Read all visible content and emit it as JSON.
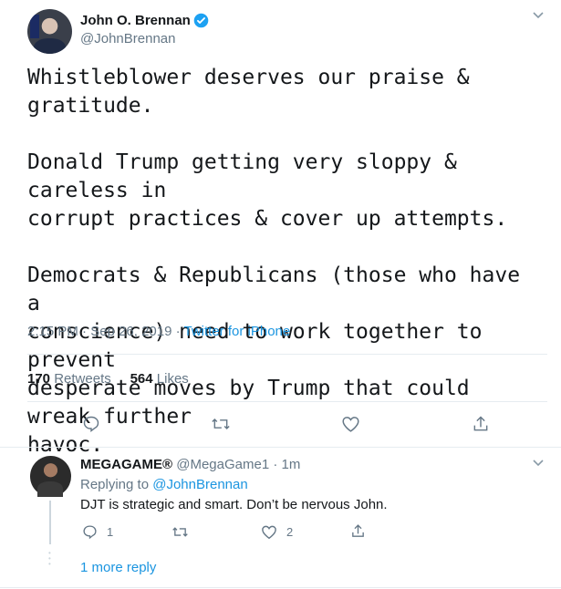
{
  "tweet": {
    "author_name": "John O. Brennan",
    "author_handle": "@JohnBrennan",
    "text": "Whistleblower deserves our praise & gratitude.\n\nDonald Trump getting very sloppy & careless in\ncorrupt practices & cover up attempts.\n\nDemocrats & Republicans (those who have a\nconscience) need to work together to prevent\ndesperate moves by Trump that could wreak further\nhavoc.",
    "timestamp": "2:15 PM · Sep 26, 2019 · ",
    "source": "Twitter for iPhone",
    "retweets_count": "170",
    "retweets_label": "Retweets",
    "likes_count": "564",
    "likes_label": "Likes"
  },
  "reply": {
    "author_name": "MEGAGAME®",
    "author_handle": "@MegaGame1 · 1m",
    "replying_to_label": "Replying to",
    "replying_to_handle": "@JohnBrennan",
    "text": "DJT is strategic and smart.   Don’t be nervous John.",
    "reply_count": "1",
    "like_count": "2"
  },
  "more_reply_label": "1 more reply",
  "colors": {
    "accent": "#1b95e0",
    "muted": "#657786",
    "divider": "#e6ecf0"
  }
}
